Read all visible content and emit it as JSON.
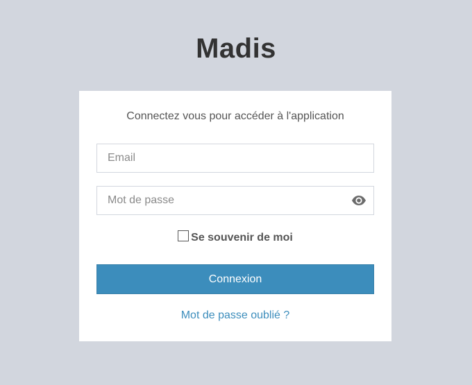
{
  "app": {
    "title": "Madis"
  },
  "login": {
    "message": "Connectez vous pour accéder à l'application",
    "email_placeholder": "Email",
    "email_value": "",
    "password_placeholder": "Mot de passe",
    "password_value": "",
    "password_toggle_icon": "eye-icon",
    "remember_label": "Se souvenir de moi",
    "remember_checked": false,
    "submit_label": "Connexion",
    "forgot_label": "Mot de passe oublié ?"
  },
  "colors": {
    "background": "#d2d6de",
    "card": "#ffffff",
    "primary": "#3c8dbc",
    "text": "#555555",
    "title": "#333333"
  }
}
